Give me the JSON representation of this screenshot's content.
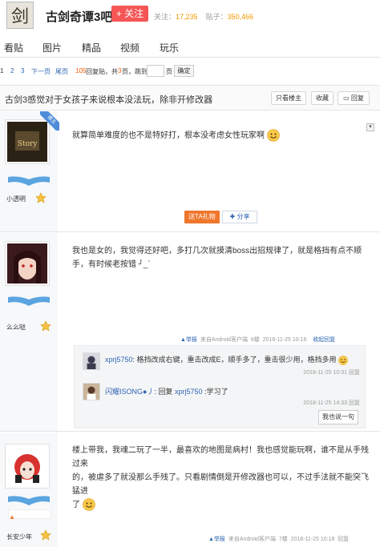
{
  "header": {
    "forum_name": "古剑奇谭3吧",
    "follow_label": "+ 关注",
    "follow_stat_label": "关注：",
    "follow_count": "17,235",
    "posts_stat_label": "贴子：",
    "posts_count": "350,466"
  },
  "nav": {
    "items": [
      "看贴",
      "图片",
      "精品",
      "视频",
      "玩乐"
    ]
  },
  "pager": {
    "pages": [
      "1",
      "2",
      "3"
    ],
    "next": "下一页",
    "last": "尾页",
    "reply_count": "105",
    "reply_suffix": "回复贴，共",
    "total_pages": "3",
    "pages_suffix": "页，跳到",
    "page_unit": "页",
    "confirm": "确定"
  },
  "thread": {
    "title": "古剑3感觉对于女孩子来说根本没法玩，除非开修改器",
    "only_op": "只看楼主",
    "favorite": "收藏",
    "reply": "回复",
    "op_badge": "楼主"
  },
  "posts": [
    {
      "username": "小透明",
      "content": "就算简单难度的也不是特好打，根本没考虑女性玩家啊",
      "gift": "送TA礼物",
      "share": "分享"
    },
    {
      "username": "么么哒",
      "content": "我也是女的，我觉得还好吧，多打几次就摸清boss出招规律了，就是格挡有点不顺手，有时候老按错 ╯_ˋ",
      "report": "举报",
      "source": "来自Android客户端",
      "floor": "6楼",
      "time": "2018-11-25 10:16",
      "collapse": "收起回复",
      "replies": [
        {
          "who": "xprj5750",
          "text": ": 格挡改成右键，重击改成E，顺手多了，重击很少用，格挡多用",
          "time": "2018-11-25 10:31",
          "action": "回复"
        },
        {
          "who": "闪耀ISONG●丿",
          "text_prefix": ": 回复 ",
          "target": "xprj5750",
          "text": " :学习了",
          "time": "2018-11-25 14:33",
          "action": "回复"
        }
      ],
      "say_more": "我也说一句"
    },
    {
      "username": "长安少年",
      "content_line1": "楼上带我，我魂二玩了一半，最喜欢的地图是病村！我也感觉能玩啊，谁不是从手残过来",
      "content_line2": "的，被虐多了就没那么手残了。只看剧情倒是开修改器也可以，不过手法就不能突飞猛进",
      "content_line3": "了",
      "report": "举报",
      "source": "来自Android客户端",
      "floor": "7楼",
      "time": "2018-11-25 10:18",
      "reply": "回复"
    }
  ]
}
